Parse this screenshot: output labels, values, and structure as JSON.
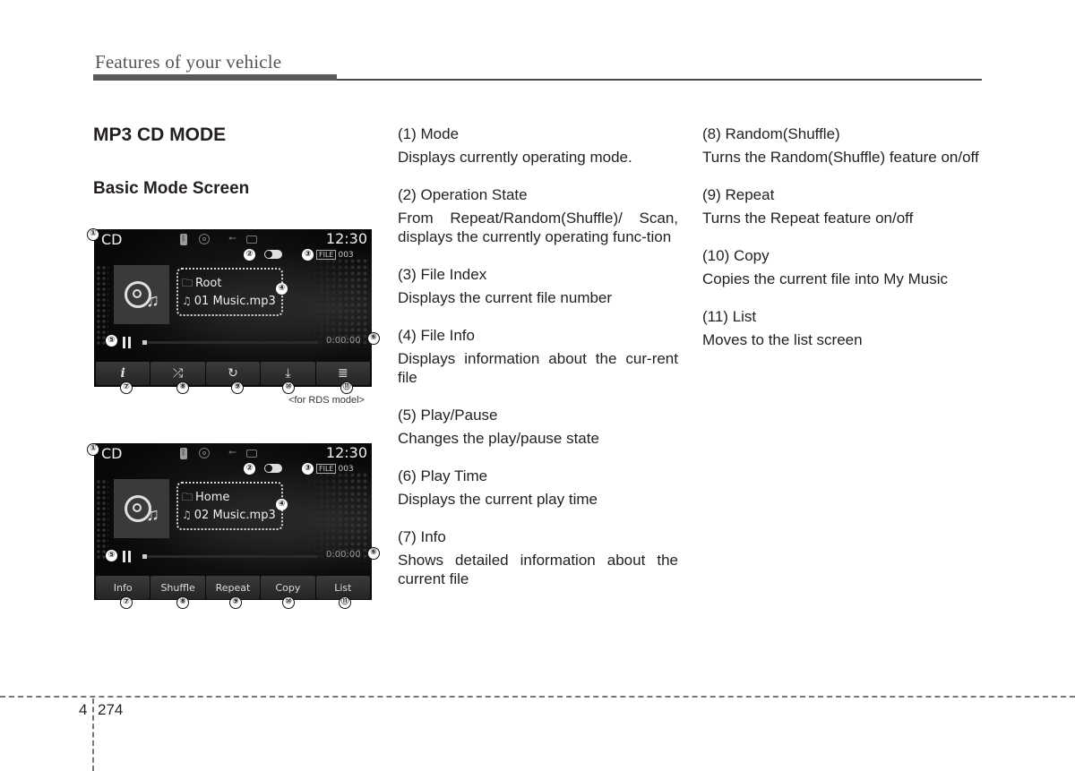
{
  "header": {
    "section_title": "Features of your vehicle"
  },
  "left": {
    "heading": "MP3 CD MODE",
    "subheading": "Basic Mode Screen",
    "rds_note": "<for RDS model>"
  },
  "screens": [
    {
      "mode": "CD",
      "clock": "12:30",
      "file_label": "FILE",
      "file_index": "003",
      "folder": "Root",
      "track": "01 Music.mp3",
      "play_time": "0:00:00",
      "progress_fraction": 0.0,
      "buttons": [
        {
          "label": "",
          "icon": "info-icon",
          "glyph": "i"
        },
        {
          "label": "",
          "icon": "shuffle-icon",
          "glyph": "⤮"
        },
        {
          "label": "",
          "icon": "repeat-icon",
          "glyph": "↻"
        },
        {
          "label": "",
          "icon": "copy-icon",
          "glyph": "⤓"
        },
        {
          "label": "",
          "icon": "list-icon",
          "glyph": "≣"
        }
      ]
    },
    {
      "mode": "CD",
      "clock": "12:30",
      "file_label": "FILE",
      "file_index": "003",
      "folder": "Home",
      "track": "02 Music.mp3",
      "play_time": "0:00:00",
      "progress_fraction": 0.0,
      "buttons": [
        {
          "label": "Info"
        },
        {
          "label": "Shuffle"
        },
        {
          "label": "Repeat"
        },
        {
          "label": "Copy"
        },
        {
          "label": "List"
        }
      ]
    }
  ],
  "callouts": [
    "①",
    "②",
    "③",
    "④",
    "⑤",
    "⑥",
    "⑦",
    "⑧",
    "⑨",
    "⑩",
    "⑪"
  ],
  "items": [
    {
      "term": "(1) Mode",
      "desc": "Displays currently operating mode."
    },
    {
      "term": "(2) Operation State",
      "desc": "From Repeat/Random(Shuffle)/ Scan, displays the currently operating func-tion"
    },
    {
      "term": "(3) File Index",
      "desc": "Displays the current file number"
    },
    {
      "term": "(4) File Info",
      "desc": "Displays information about the cur-rent file"
    },
    {
      "term": "(5) Play/Pause",
      "desc": "Changes the play/pause state"
    },
    {
      "term": "(6) Play Time",
      "desc": "Displays the current play time"
    },
    {
      "term": "(7) Info",
      "desc": "Shows detailed information about the current file"
    },
    {
      "term": "(8) Random(Shuffle)",
      "desc": "Turns the Random(Shuffle) feature on/off"
    },
    {
      "term": "(9) Repeat",
      "desc": "Turns the Repeat feature on/off"
    },
    {
      "term": "(10) Copy",
      "desc": "Copies the current file into My Music"
    },
    {
      "term": "(11) List",
      "desc": "Moves to the list screen"
    }
  ],
  "footer": {
    "chapter": "4",
    "page": "274"
  }
}
